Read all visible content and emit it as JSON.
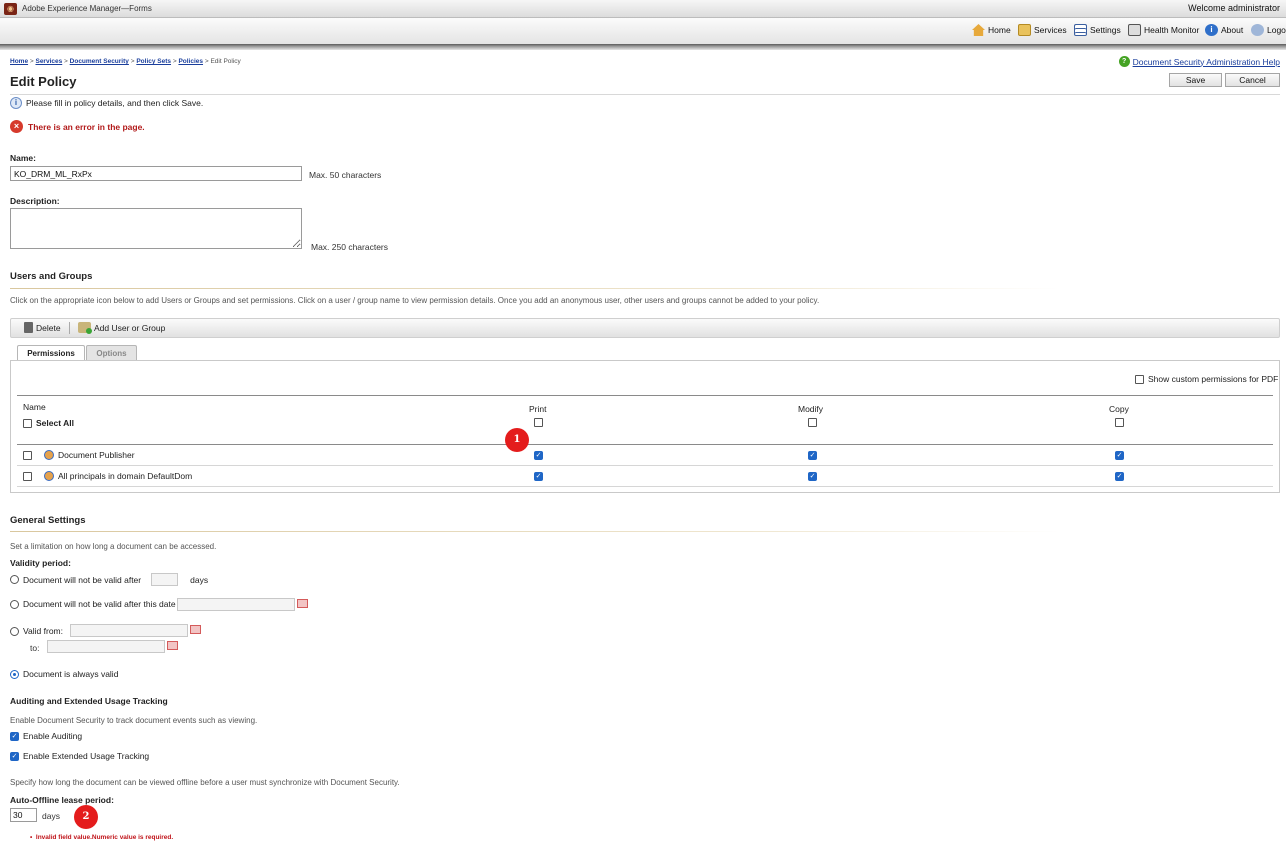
{
  "app": {
    "title": "Adobe Experience Manager—Forms",
    "welcome": "Welcome administrator"
  },
  "nav": [
    {
      "label": "Home",
      "icon": "home-icon"
    },
    {
      "label": "Services",
      "icon": "services-icon"
    },
    {
      "label": "Settings",
      "icon": "settings-icon"
    },
    {
      "label": "Health Monitor",
      "icon": "health-monitor-icon"
    },
    {
      "label": "About",
      "icon": "about-icon"
    },
    {
      "label": "Logo",
      "icon": "logout-icon"
    }
  ],
  "breadcrumb": {
    "items": [
      "Home",
      "Services",
      "Document Security",
      "Policy Sets",
      "Policies"
    ],
    "current": "Edit Policy",
    "sep": " > "
  },
  "help_link": "Document Security Administration Help",
  "page_title": "Edit Policy",
  "buttons": {
    "save": "Save",
    "cancel": "Cancel"
  },
  "info_message": "Please fill in policy details, and then click Save.",
  "error_message": "There is an error in the page.",
  "form": {
    "name_label": "Name:",
    "name_value": "KO_DRM_ML_RxPx",
    "name_note": "Max. 50 characters",
    "description_label": "Description:",
    "description_value": "",
    "description_note": "Max. 250 characters"
  },
  "users_groups": {
    "title": "Users and Groups",
    "description": "Click on the appropriate icon below to add Users or Groups and set permissions. Click on a user / group name to view permission details. Once you add an anonymous user, other users and groups cannot be added to your policy.",
    "toolbar": {
      "delete": "Delete",
      "add": "Add User or Group"
    },
    "tabs": [
      "Permissions",
      "Options"
    ],
    "show_custom": "Show custom permissions for PDF",
    "columns": {
      "name": "Name",
      "print": "Print",
      "modify": "Modify",
      "copy": "Copy"
    },
    "select_all": "Select All",
    "rows": [
      {
        "name": "Document Publisher",
        "print": true,
        "modify": true,
        "copy": true
      },
      {
        "name": "All principals in domain DefaultDom",
        "print": true,
        "modify": true,
        "copy": true
      }
    ]
  },
  "general": {
    "title": "General Settings",
    "description": "Set a limitation on how long a document can be accessed.",
    "validity_label": "Validity period:",
    "opt_days": "Document will not be valid after",
    "days_suffix": "days",
    "opt_date": "Document will not be valid after this date",
    "opt_from": "Valid from:",
    "to_label": "to:",
    "opt_always": "Document is always valid",
    "selected_option": "always"
  },
  "auditing": {
    "title": "Auditing and Extended Usage Tracking",
    "description": "Enable Document Security to track document events such as viewing.",
    "enable_auditing": "Enable Auditing",
    "enable_tracking": "Enable Extended Usage Tracking",
    "offline_description": "Specify how long the document can be viewed offline before a user must synchronize with Document Security.",
    "lease_label": "Auto-Offline lease period:",
    "lease_value": "30",
    "lease_suffix": "days",
    "lease_error": "Invalid field value.Numeric value is required."
  },
  "markers": [
    "1",
    "2"
  ]
}
